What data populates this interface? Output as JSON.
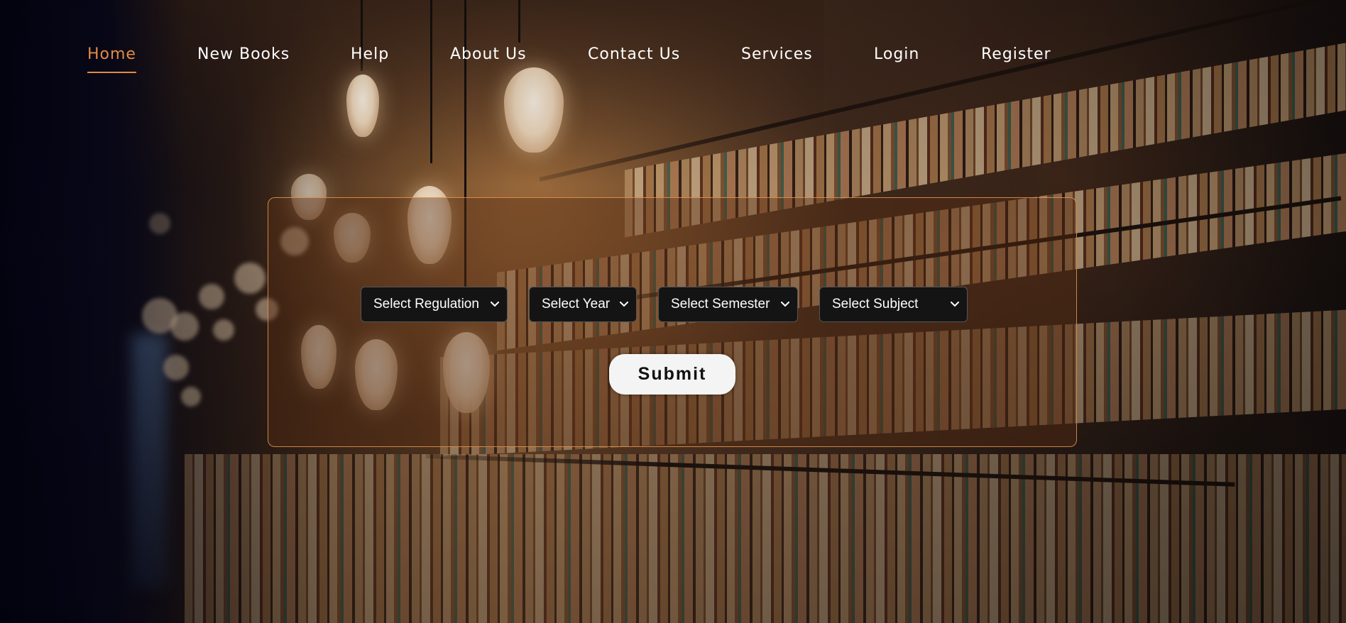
{
  "nav": {
    "items": [
      {
        "label": "Home",
        "active": true
      },
      {
        "label": "New Books",
        "active": false
      },
      {
        "label": "Help",
        "active": false
      },
      {
        "label": "About Us",
        "active": false
      },
      {
        "label": "Contact Us",
        "active": false
      },
      {
        "label": "Services",
        "active": false
      },
      {
        "label": "Login",
        "active": false
      },
      {
        "label": "Register",
        "active": false
      }
    ],
    "active_color": "#e38a45"
  },
  "form": {
    "selects": [
      {
        "value": "Select Regulation"
      },
      {
        "value": "Select Year"
      },
      {
        "value": "Select Semester"
      },
      {
        "value": "Select Subject"
      }
    ],
    "submit_label": "Submit",
    "panel_border_color": "#e6964f"
  }
}
